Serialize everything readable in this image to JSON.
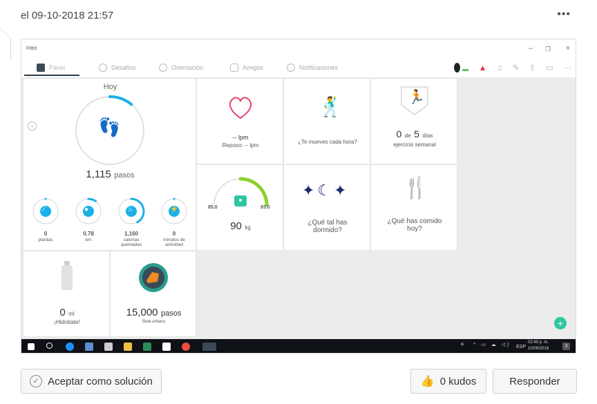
{
  "post": {
    "date": "el 09-10-2018 21:57",
    "more": "•••"
  },
  "app": {
    "title": "Fitbit"
  },
  "nav": {
    "tabs": [
      {
        "label": "Panel"
      },
      {
        "label": "Desafíos"
      },
      {
        "label": "Orientación"
      },
      {
        "label": "Amigos"
      },
      {
        "label": "Notificaciones"
      }
    ]
  },
  "today": {
    "title": "Hoy",
    "steps_value": "1,115",
    "steps_unit": "pasos",
    "steps_progress": 0.11,
    "stats": [
      {
        "value": "0",
        "label": "plantas",
        "progress": 0,
        "color": "#1ab0e8"
      },
      {
        "value": "0.78",
        "label": "km",
        "progress": 0.1,
        "color": "#1ab0e8"
      },
      {
        "value": "1,160",
        "label": "calorías quemadas",
        "progress": 0.42,
        "color": "#1ab0e8"
      },
      {
        "value": "0",
        "label": "minutos de actividad",
        "progress": 0,
        "color": "#1ab0e8"
      }
    ]
  },
  "heart": {
    "value": "-- lpm",
    "resting": "Reposo: -- lpm"
  },
  "hourly": {
    "label": "¿Te mueves cada hora?"
  },
  "exercise": {
    "value": "0",
    "of": "de",
    "target": "5",
    "unit": "días",
    "label": "ejercicio semanal"
  },
  "weight": {
    "min": "85.0",
    "max": "93.0",
    "value": "90",
    "unit": "kg"
  },
  "sleep": {
    "label": "¿Qué tal has dormido?"
  },
  "food": {
    "label": "¿Qué has comido hoy?"
  },
  "water": {
    "value": "0",
    "unit": "ml",
    "label": "¡Hidrátate!"
  },
  "badge": {
    "value": "15,000",
    "unit": "pasos",
    "label": "Bota urbana"
  },
  "taskbar": {
    "lang": "ESP",
    "time": "02:49 p. m.",
    "date": "10/09/2018",
    "notif": "3"
  },
  "footer": {
    "accept": "Aceptar como solución",
    "kudos": "0 kudos",
    "reply": "Responder"
  },
  "colors": {
    "accent": "#1ab0e8",
    "heart": "#e8456b",
    "green": "#2fc7a0",
    "lime": "#8bd12c"
  }
}
